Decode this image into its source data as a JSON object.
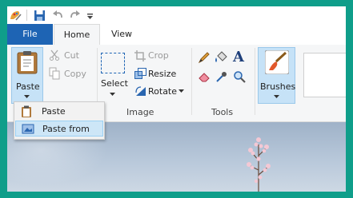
{
  "tabs": [
    {
      "label": "File"
    },
    {
      "label": "Home"
    },
    {
      "label": "View"
    }
  ],
  "clipboard": {
    "paste": "Paste",
    "cut": "Cut",
    "copy": "Copy"
  },
  "image": {
    "select": "Select",
    "crop": "Crop",
    "resize": "Resize",
    "rotate": "Rotate",
    "group": "Image"
  },
  "tools": {
    "group": "Tools"
  },
  "brushes": {
    "label": "Brushes"
  },
  "paste_menu": {
    "items": [
      {
        "label": "Paste"
      },
      {
        "label": "Paste from"
      }
    ]
  },
  "colors": {
    "accent": "#1e64b4",
    "frame": "#0f9e8a",
    "highlight": "#cde6f7"
  }
}
